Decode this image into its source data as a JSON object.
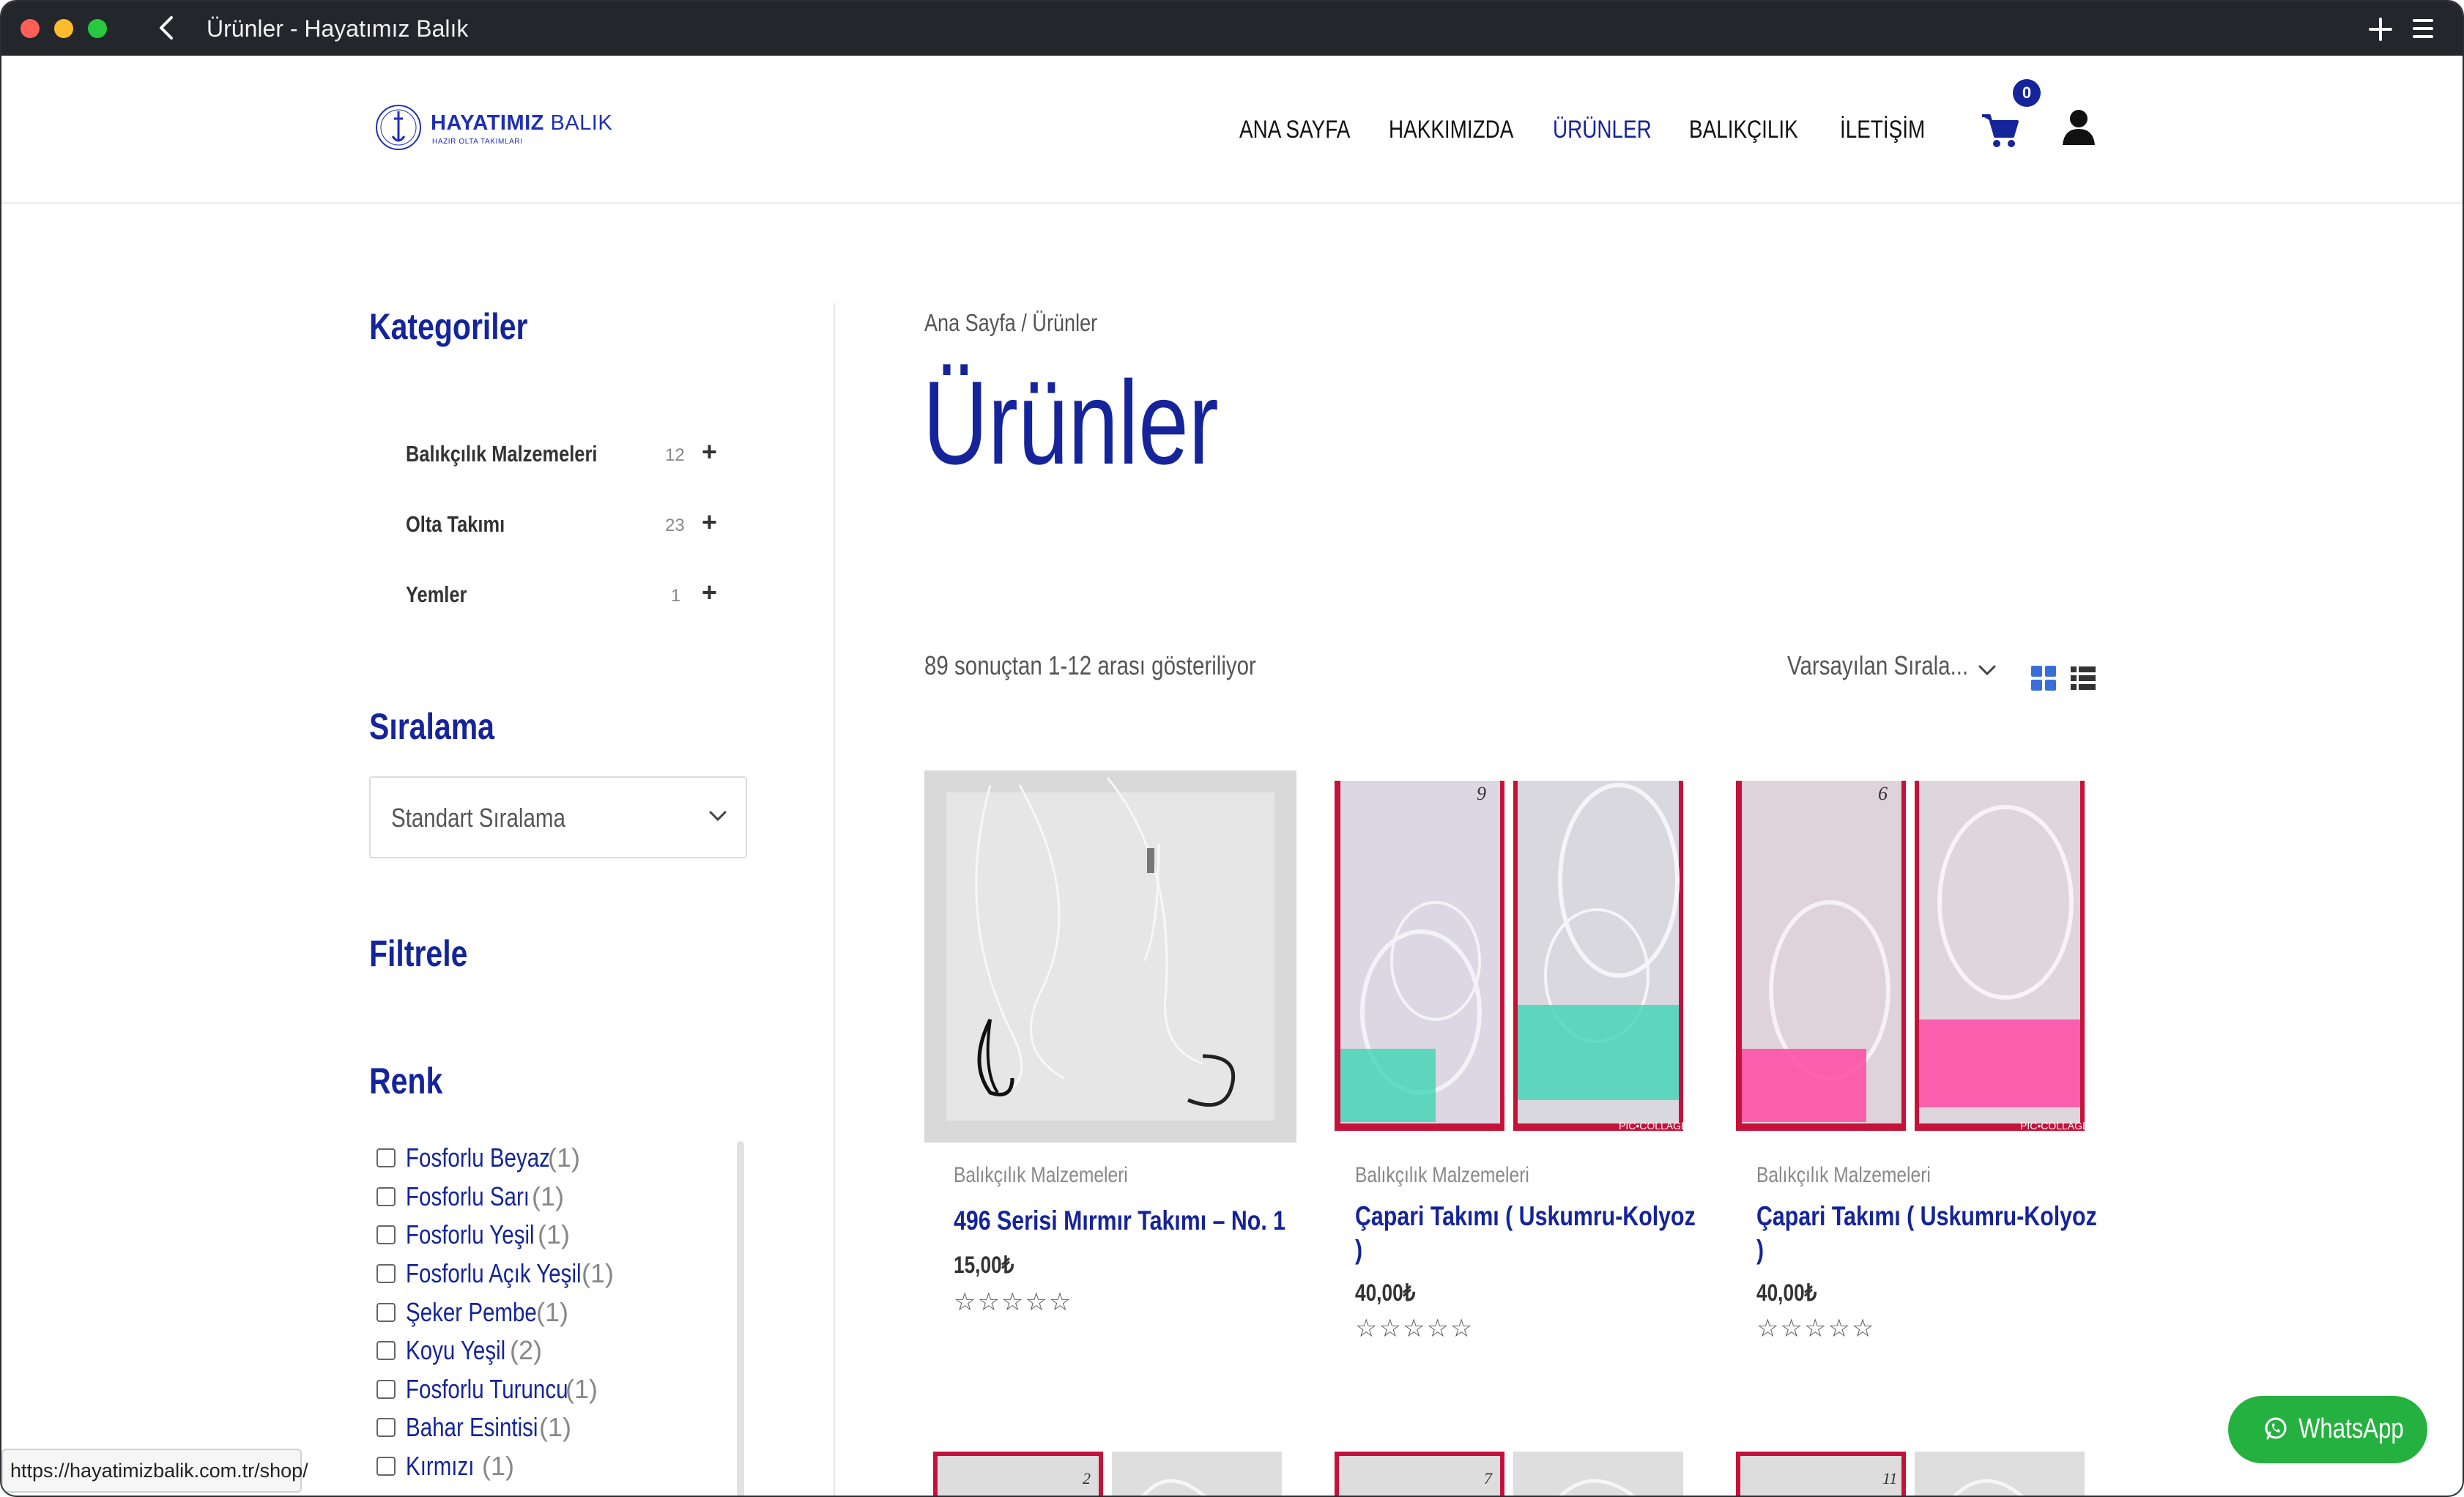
{
  "window": {
    "title": "Ürünler - Hayatımız Balık"
  },
  "brand": {
    "name_bold": "HAYATIMIZ",
    "name_light": "BALIK",
    "tagline": "HAZIR OLTA TAKIMLARI"
  },
  "nav": {
    "items": [
      {
        "label": "ANA SAYFA",
        "active": false
      },
      {
        "label": "HAKKIMIZDA",
        "active": false
      },
      {
        "label": "ÜRÜNLER",
        "active": true
      },
      {
        "label": "BALIKÇILIK",
        "active": false
      },
      {
        "label": "İLETİŞİM",
        "active": false
      }
    ],
    "cart_count": "0"
  },
  "sidebar": {
    "categories_title": "Kategoriler",
    "categories": [
      {
        "name": "Balıkçılık Malzemeleri",
        "count": "12"
      },
      {
        "name": "Olta Takımı",
        "count": "23"
      },
      {
        "name": "Yemler",
        "count": "1"
      }
    ],
    "sorting_title": "Sıralama",
    "sorting_value": "Standart Sıralama",
    "filter_title": "Filtrele",
    "color_title": "Renk",
    "colors": [
      {
        "label": "Fosforlu Beyaz",
        "count": "(1)"
      },
      {
        "label": "Fosforlu Sarı",
        "count": "(1)"
      },
      {
        "label": "Fosforlu Yeşil",
        "count": "(1)"
      },
      {
        "label": "Fosforlu Açık Yeşil",
        "count": "(1)"
      },
      {
        "label": "Şeker Pembe",
        "count": "(1)"
      },
      {
        "label": "Koyu Yeşil",
        "count": "(2)"
      },
      {
        "label": "Fosforlu Turuncu",
        "count": "(1)"
      },
      {
        "label": "Bahar Esintisi",
        "count": "(1)"
      },
      {
        "label": "Kırmızı",
        "count": "(1)"
      }
    ]
  },
  "status_url": "https://hayatimizbalik.com.tr/shop/",
  "main": {
    "breadcrumb": "Ana Sayfa / Ürünler",
    "title": "Ürünler",
    "results_text": "89 sonuçtan 1-12 arası gösteriliyor",
    "orderby_value": "Varsayılan Sırala...",
    "products": [
      {
        "category": "Balıkçılık Malzemeleri",
        "title_1": "496 Serisi Mırmır Takımı – No. 1",
        "title_2": "",
        "price": "15,00₺",
        "rating": "☆☆☆☆☆",
        "number_mark": ""
      },
      {
        "category": "Balıkçılık Malzemeleri",
        "title_1": "Çapari Takımı ( Uskumru-Kolyoz",
        "title_2": ")",
        "price": "40,00₺",
        "rating": "☆☆☆☆☆",
        "number_mark": "9",
        "watermark": "PIC•COLLAGE"
      },
      {
        "category": "Balıkçılık Malzemeleri",
        "title_1": "Çapari Takımı ( Uskumru-Kolyoz",
        "title_2": ")",
        "price": "40,00₺",
        "rating": "☆☆☆☆☆",
        "number_mark": "6",
        "watermark": "PIC•COLLAGE"
      }
    ],
    "row2_marks": [
      "2",
      "7",
      "11"
    ]
  },
  "whatsapp": {
    "label": "WhatsApp",
    "color": "#25b13f"
  },
  "colors": {
    "brand": "#15249a",
    "titlebar": "#23262b"
  }
}
